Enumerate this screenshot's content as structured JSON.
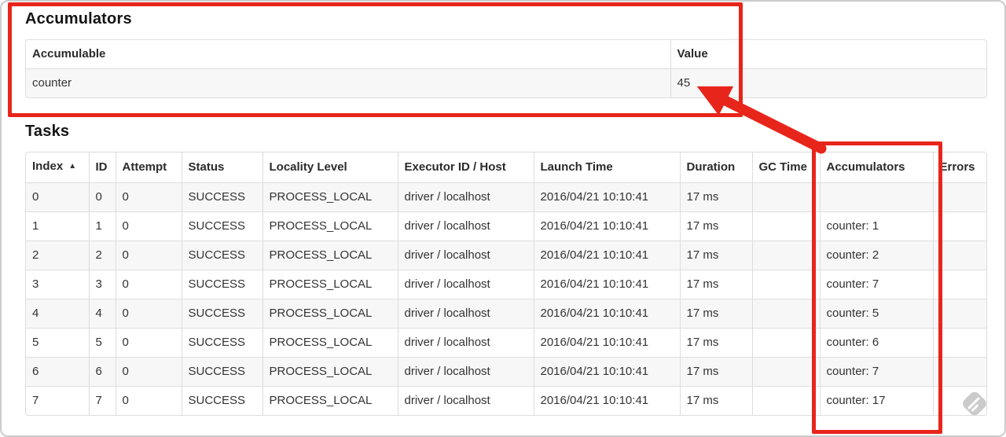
{
  "accumulators_section": {
    "title": "Accumulators",
    "table": {
      "headers": [
        "Accumulable",
        "Value"
      ],
      "rows": [
        [
          "counter",
          "45"
        ]
      ]
    }
  },
  "tasks_section": {
    "title": "Tasks",
    "table": {
      "sort_icon": "▲",
      "headers": [
        "Index",
        "ID",
        "Attempt",
        "Status",
        "Locality Level",
        "Executor ID / Host",
        "Launch Time",
        "Duration",
        "GC Time",
        "Accumulators",
        "Errors"
      ],
      "rows": [
        [
          "0",
          "0",
          "0",
          "SUCCESS",
          "PROCESS_LOCAL",
          "driver / localhost",
          "2016/04/21 10:10:41",
          "17 ms",
          "",
          "",
          ""
        ],
        [
          "1",
          "1",
          "0",
          "SUCCESS",
          "PROCESS_LOCAL",
          "driver / localhost",
          "2016/04/21 10:10:41",
          "17 ms",
          "",
          "counter: 1",
          ""
        ],
        [
          "2",
          "2",
          "0",
          "SUCCESS",
          "PROCESS_LOCAL",
          "driver / localhost",
          "2016/04/21 10:10:41",
          "17 ms",
          "",
          "counter: 2",
          ""
        ],
        [
          "3",
          "3",
          "0",
          "SUCCESS",
          "PROCESS_LOCAL",
          "driver / localhost",
          "2016/04/21 10:10:41",
          "17 ms",
          "",
          "counter: 7",
          ""
        ],
        [
          "4",
          "4",
          "0",
          "SUCCESS",
          "PROCESS_LOCAL",
          "driver / localhost",
          "2016/04/21 10:10:41",
          "17 ms",
          "",
          "counter: 5",
          ""
        ],
        [
          "5",
          "5",
          "0",
          "SUCCESS",
          "PROCESS_LOCAL",
          "driver / localhost",
          "2016/04/21 10:10:41",
          "17 ms",
          "",
          "counter: 6",
          ""
        ],
        [
          "6",
          "6",
          "0",
          "SUCCESS",
          "PROCESS_LOCAL",
          "driver / localhost",
          "2016/04/21 10:10:41",
          "17 ms",
          "",
          "counter: 7",
          ""
        ],
        [
          "7",
          "7",
          "0",
          "SUCCESS",
          "PROCESS_LOCAL",
          "driver / localhost",
          "2016/04/21 10:10:41",
          "17 ms",
          "",
          "counter: 17",
          ""
        ]
      ]
    }
  },
  "annotations": {
    "color": "#e8251a"
  }
}
